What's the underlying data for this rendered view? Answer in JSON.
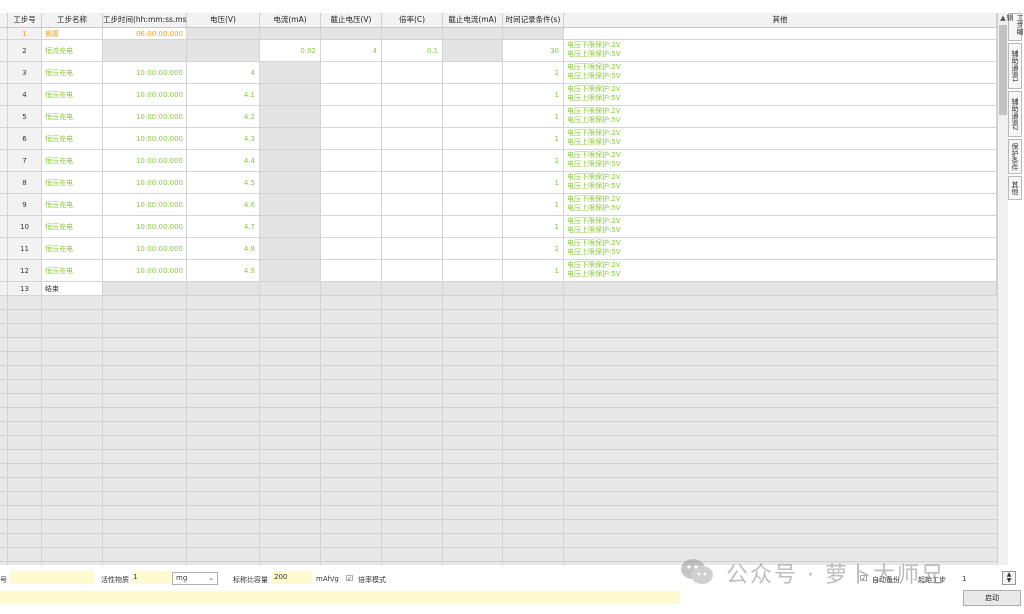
{
  "columns": [
    "工步号",
    "工步名称",
    "工步时间(hh:mm:ss.ms)",
    "电压(V)",
    "电流(mA)",
    "截止电压(V)",
    "倍率(C)",
    "截止电流(mA)",
    "时间记录条件(s)",
    "其他"
  ],
  "rows": [
    {
      "no": "1",
      "name": "搁置",
      "time": "06:00:00.000",
      "voltage": "",
      "current": "",
      "cutoff_v": "",
      "rate": "",
      "cutoff_i": "",
      "rec": "",
      "other": [
        "",
        ""
      ],
      "kind": "rest"
    },
    {
      "no": "2",
      "name": "恒流充电",
      "time": "",
      "voltage": "",
      "current": "0.02",
      "cutoff_v": "4",
      "rate": "0.1",
      "cutoff_i": "",
      "rec": "30",
      "other": [
        "电压下限保护:2V",
        "电压上限保护:5V"
      ],
      "kind": "cc"
    },
    {
      "no": "3",
      "name": "恒压充电",
      "time": "10:00:00.000",
      "voltage": "4",
      "current": "",
      "cutoff_v": "",
      "rate": "",
      "cutoff_i": "",
      "rec": "1",
      "other": [
        "电压下限保护:2V",
        "电压上限保护:5V"
      ],
      "kind": "cv"
    },
    {
      "no": "4",
      "name": "恒压充电",
      "time": "10:00:00.000",
      "voltage": "4.1",
      "current": "",
      "cutoff_v": "",
      "rate": "",
      "cutoff_i": "",
      "rec": "1",
      "other": [
        "电压下限保护:2V",
        "电压上限保护:5V"
      ],
      "kind": "cv"
    },
    {
      "no": "5",
      "name": "恒压充电",
      "time": "10:00:00.000",
      "voltage": "4.2",
      "current": "",
      "cutoff_v": "",
      "rate": "",
      "cutoff_i": "",
      "rec": "1",
      "other": [
        "电压下限保护:2V",
        "电压上限保护:5V"
      ],
      "kind": "cv"
    },
    {
      "no": "6",
      "name": "恒压充电",
      "time": "10:00:00.000",
      "voltage": "4.3",
      "current": "",
      "cutoff_v": "",
      "rate": "",
      "cutoff_i": "",
      "rec": "1",
      "other": [
        "电压下限保护:2V",
        "电压上限保护:5V"
      ],
      "kind": "cv"
    },
    {
      "no": "7",
      "name": "恒压充电",
      "time": "10:00:00.000",
      "voltage": "4.4",
      "current": "",
      "cutoff_v": "",
      "rate": "",
      "cutoff_i": "",
      "rec": "1",
      "other": [
        "电压下限保护:2V",
        "电压上限保护:5V"
      ],
      "kind": "cv"
    },
    {
      "no": "8",
      "name": "恒压充电",
      "time": "10:00:00.000",
      "voltage": "4.5",
      "current": "",
      "cutoff_v": "",
      "rate": "",
      "cutoff_i": "",
      "rec": "1",
      "other": [
        "电压下限保护:2V",
        "电压上限保护:5V"
      ],
      "kind": "cv"
    },
    {
      "no": "9",
      "name": "恒压充电",
      "time": "10:00:00.000",
      "voltage": "4.6",
      "current": "",
      "cutoff_v": "",
      "rate": "",
      "cutoff_i": "",
      "rec": "1",
      "other": [
        "电压下限保护:2V",
        "电压上限保护:5V"
      ],
      "kind": "cv"
    },
    {
      "no": "10",
      "name": "恒压充电",
      "time": "10:00:00.000",
      "voltage": "4.7",
      "current": "",
      "cutoff_v": "",
      "rate": "",
      "cutoff_i": "",
      "rec": "1",
      "other": [
        "电压下限保护:2V",
        "电压上限保护:5V"
      ],
      "kind": "cv"
    },
    {
      "no": "11",
      "name": "恒压充电",
      "time": "10:00:00.000",
      "voltage": "4.8",
      "current": "",
      "cutoff_v": "",
      "rate": "",
      "cutoff_i": "",
      "rec": "1",
      "other": [
        "电压下限保护:2V",
        "电压上限保护:5V"
      ],
      "kind": "cv"
    },
    {
      "no": "12",
      "name": "恒压充电",
      "time": "10:00:00.000",
      "voltage": "4.9",
      "current": "",
      "cutoff_v": "",
      "rate": "",
      "cutoff_i": "",
      "rec": "1",
      "other": [
        "电压下限保护:2V",
        "电压上限保护:5V"
      ],
      "kind": "cv"
    },
    {
      "no": "13",
      "name": "结束",
      "time": "",
      "voltage": "",
      "current": "",
      "cutoff_v": "",
      "rate": "",
      "cutoff_i": "",
      "rec": "",
      "other": [
        "",
        ""
      ],
      "kind": "end"
    }
  ],
  "side_tabs": [
    "工步编辑",
    "辅助通道1",
    "辅助通道2",
    "保护条件",
    "其他"
  ],
  "bottom": {
    "serial_label": "号",
    "serial_value": "",
    "active_material_label": "活性物质",
    "active_material_value": "1",
    "unit_value": "mg",
    "nominal_capacity_label": "标称比容量",
    "nominal_capacity_value": "200",
    "nominal_capacity_unit": "mAh/g",
    "rate_mode_label": "倍率模式",
    "rate_mode_checked": "☑",
    "auto_backup_label": "自动备份",
    "auto_backup_checked": "☑",
    "start_step_label": "起始工步",
    "start_step_value": "1",
    "start_button": "启动"
  },
  "watermark": {
    "text": "公众号 · 萝卜大师兄"
  },
  "colors": {
    "green_text": "#8cc63f",
    "orange_text": "#e8a317",
    "input_yellow": "#fffbd0"
  }
}
